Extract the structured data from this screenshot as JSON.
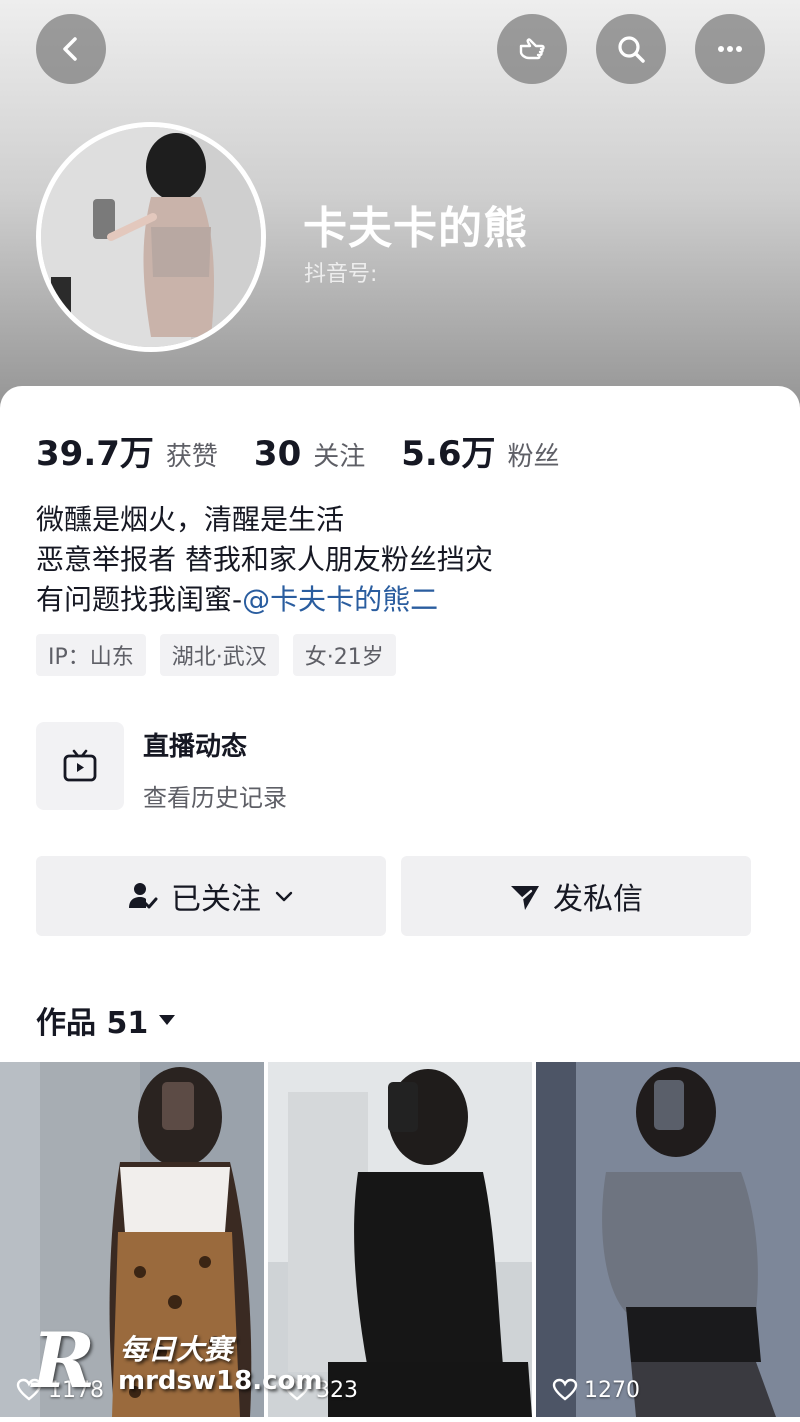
{
  "header": {
    "nickname": "卡夫卡的熊",
    "douyin_id_label": "抖音号:",
    "icons": [
      "back-icon",
      "hand-pointer-icon",
      "search-icon",
      "more-icon"
    ]
  },
  "stats": [
    {
      "value": "39.7万",
      "label": "获赞"
    },
    {
      "value": "30",
      "label": "关注"
    },
    {
      "value": "5.6万",
      "label": "粉丝"
    }
  ],
  "bio": {
    "line1": "微醺是烟火，清醒是生活",
    "line2": "恶意举报者 替我和家人朋友粉丝挡灾",
    "line3_prefix": "有问题找我闺蜜-",
    "line3_mention": "@卡夫卡的熊二"
  },
  "tags": [
    "IP：山东",
    "湖北·武汉",
    "女·21岁"
  ],
  "live": {
    "title": "直播动态",
    "subtitle": "查看历史记录"
  },
  "actions": {
    "follow_label": "已关注",
    "message_label": "发私信"
  },
  "works": {
    "label": "作品 51"
  },
  "grid": [
    {
      "likes": "1178"
    },
    {
      "likes": "323"
    },
    {
      "likes": "1270"
    }
  ],
  "watermark": {
    "logo_letter": "R",
    "name": "每日大赛",
    "url": "mrdsw18.com"
  },
  "colors": {
    "mention": "#2a5d9f",
    "text_primary": "#161823",
    "text_secondary": "#5e5f66",
    "chip_bg": "#f2f2f4"
  }
}
